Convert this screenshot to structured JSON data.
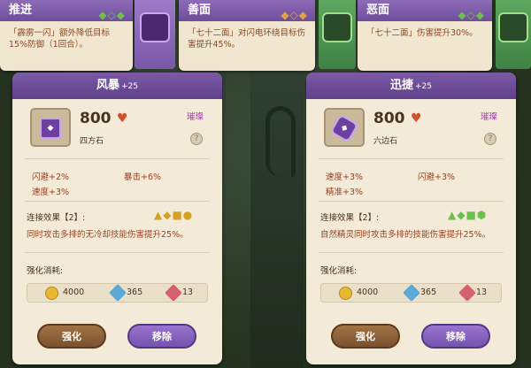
{
  "top_strips": [
    {
      "title": "推进",
      "shapes": "◆◇◆",
      "desc": "「霹雳一闪」额外降低目标15%防御（1回合）。"
    },
    {
      "title": "善面",
      "shapes": "◆◇◆",
      "desc": "「七十二面」对闪电环绕目标伤害提升45%。"
    },
    {
      "title": "恶面",
      "shapes": "◆◇◆",
      "desc": "「七十二面」伤害提升30%。"
    }
  ],
  "left_panel": {
    "title": "风暴",
    "level": "+25",
    "score": "800",
    "item_name": "四方石",
    "rarity": "璀璨",
    "stats": [
      "闪避+2%",
      "暴击+6%",
      "速度+3%"
    ],
    "set_label": "连接效果【2】:",
    "set_shapes": "▲◆■●",
    "set_desc": "同时攻击多排的无冷却技能伤害提升25%。",
    "cost_label": "强化消耗:",
    "costs": [
      "4000",
      "365",
      "13"
    ],
    "btn_enhance": "强化",
    "btn_remove": "移除"
  },
  "right_panel": {
    "title": "迅捷",
    "level": "+25",
    "score": "800",
    "item_name": "六边石",
    "rarity": "璀璨",
    "stats": [
      "速度+3%",
      "闪避+3%",
      "精准+3%"
    ],
    "set_label": "连接效果【2】:",
    "set_shapes": "▲◆■⬢",
    "set_desc": "自然精灵同时攻击多排的技能伤害提升25%。",
    "cost_label": "强化消耗:",
    "costs": [
      "4000",
      "365",
      "13"
    ],
    "btn_enhance": "强化",
    "btn_remove": "移除"
  },
  "colors": {
    "panel_bg": "#f3ead8",
    "header_purple": "#6e4e9c",
    "stat_red": "#9b3f1e",
    "coin": "#e8b92e"
  }
}
